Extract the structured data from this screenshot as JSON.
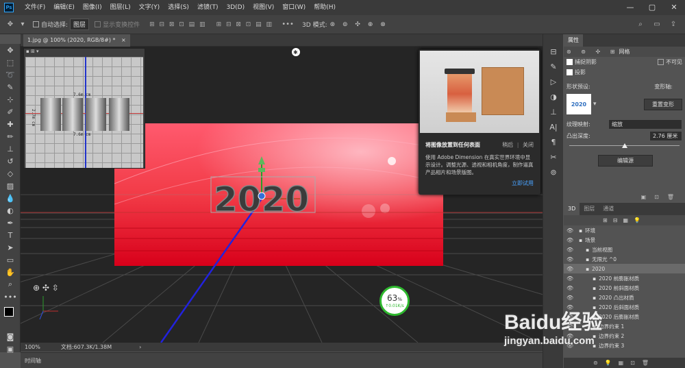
{
  "app": {
    "logo": "Ps"
  },
  "menu": [
    "文件(F)",
    "编辑(E)",
    "图像(I)",
    "图层(L)",
    "文字(Y)",
    "选择(S)",
    "滤镜(T)",
    "3D(D)",
    "视图(V)",
    "窗口(W)",
    "帮助(H)"
  ],
  "options": {
    "auto_select_label": "自动选择:",
    "auto_select_value": "图层",
    "transform_label": "显示变换控件",
    "mode_label": "3D 模式:"
  },
  "document": {
    "tab_label": "1.jpg @ 100% (2020, RGB/8#) *",
    "close": "×",
    "zoom": "100%",
    "doc_info": "文档:607.3K/1.38M"
  },
  "timeline": {
    "label": "时间轴"
  },
  "canvas": {
    "text_3d": "2020",
    "ruler_label": "7.6m cm",
    "ruler_label2": "7.6m cm",
    "ruler_side": "2.7m cm"
  },
  "net": {
    "percent": "63",
    "percent_unit": "%",
    "speed": "0.01K/s"
  },
  "promo": {
    "title": "将图像放置到任何表面",
    "later": "稍后",
    "close": "关闭",
    "body": "使用 Adobe Dimension 在真实世界环境中显示设计。调整光源、透视和相机角度，制作逼真产品相片和场景版图。",
    "link": "立即试用"
  },
  "properties": {
    "tab": "属性",
    "mesh": "网格",
    "catch_shadow": "捕捉阴影",
    "invisible": "不可见",
    "cast_shadow": "投影",
    "shape_preset_label": "形状预设:",
    "deform_axis_label": "变形轴:",
    "reset_deform": "重置变形",
    "texture_label": "纹理映射:",
    "texture_value": "缩放",
    "extrude_label": "凸出深度:",
    "extrude_value": "2.76 厘米",
    "edit_source": "编辑源",
    "preset_thumb": "2020",
    "extrude_fraction": 0.5
  },
  "layers_panel": {
    "tabs": [
      "3D",
      "图层",
      "通道"
    ],
    "items": [
      {
        "label": "环境",
        "indent": 0
      },
      {
        "label": "场景",
        "indent": 0
      },
      {
        "label": "当前视图",
        "indent": 1
      },
      {
        "label": "无限光 ^0",
        "indent": 1
      },
      {
        "label": "2020",
        "indent": 1,
        "selected": true
      },
      {
        "label": "2020 前膨胀材质",
        "indent": 2
      },
      {
        "label": "2020 前斜面材质",
        "indent": 2
      },
      {
        "label": "2020 凸出材质",
        "indent": 2
      },
      {
        "label": "2020 后斜面材质",
        "indent": 2
      },
      {
        "label": "2020 后膨胀材质",
        "indent": 2
      },
      {
        "label": "边界约束 1",
        "indent": 2
      },
      {
        "label": "边界约束 2",
        "indent": 2
      },
      {
        "label": "边界约束 3",
        "indent": 2
      }
    ]
  },
  "watermark": {
    "main": "Baidu经验",
    "url": "jingyan.baidu.com"
  }
}
